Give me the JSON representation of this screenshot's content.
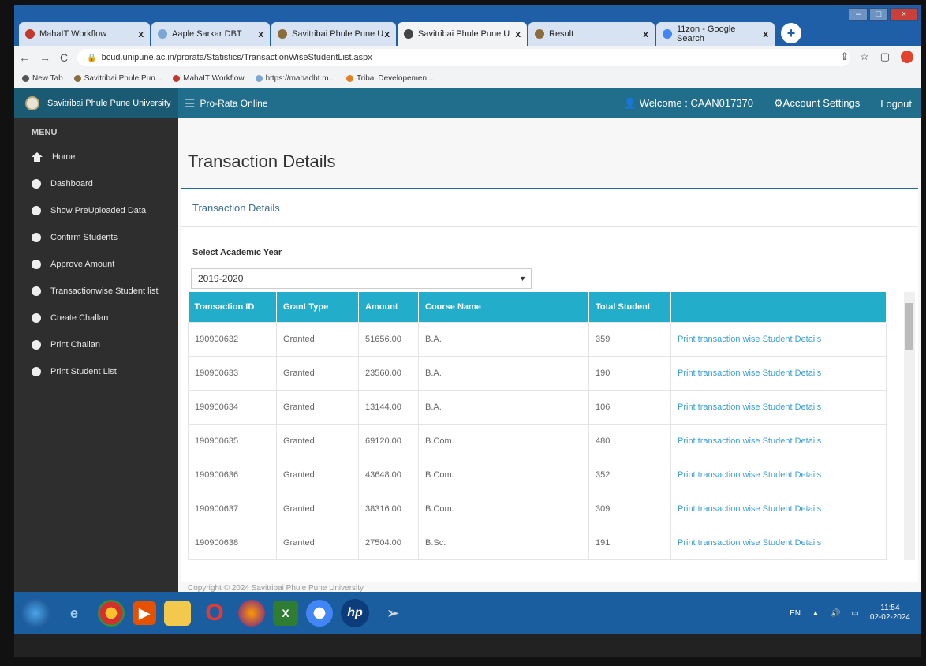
{
  "browser": {
    "tabs": [
      {
        "label": "MahaIT Workflow",
        "close": "x"
      },
      {
        "label": "Aaple Sarkar DBT",
        "close": "x"
      },
      {
        "label": "Savitribai Phule Pune U",
        "close": "x"
      },
      {
        "label": "Savitribai Phule Pune U",
        "close": "x"
      },
      {
        "label": "Result",
        "close": "x"
      },
      {
        "label": "11zon - Google Search",
        "close": "x"
      }
    ],
    "url": "bcud.unipune.ac.in/prorata/Statistics/TransactionWiseStudentList.aspx",
    "bookmarks": [
      "New Tab",
      "Savitribai Phule Pun...",
      "MahaIT Workflow",
      "https://mahadbt.m...",
      "Tribal Developemen..."
    ]
  },
  "header": {
    "brand": "Savitribai Phule Pune University",
    "app_name": "Pro-Rata Online",
    "welcome": "Welcome : CAAN017370",
    "account_settings": "Account Settings",
    "logout": "Logout"
  },
  "sidebar": {
    "title": "MENU",
    "items": [
      {
        "label": "Home",
        "icon": "home-icon"
      },
      {
        "label": "Dashboard",
        "icon": "dashboard-icon"
      },
      {
        "label": "Show PreUploaded Data",
        "icon": "circle-icon"
      },
      {
        "label": "Confirm Students",
        "icon": "circle-icon"
      },
      {
        "label": "Approve Amount",
        "icon": "circle-icon"
      },
      {
        "label": "Transactionwise Student list",
        "icon": "circle-icon"
      },
      {
        "label": "Create Challan",
        "icon": "circle-icon"
      },
      {
        "label": "Print Challan",
        "icon": "circle-icon"
      },
      {
        "label": "Print Student List",
        "icon": "circle-icon"
      }
    ]
  },
  "main": {
    "page_title": "Transaction Details",
    "panel_title": "Transaction Details",
    "year_label": "Select Academic Year",
    "year_value": "2019-2020",
    "columns": [
      "Transaction ID",
      "Grant Type",
      "Amount",
      "Course Name",
      "Total Student",
      ""
    ],
    "rows": [
      {
        "id": "190900632",
        "grant": "Granted",
        "amount": "51656.00",
        "course": "B.A.",
        "total": "359",
        "action": "Print transaction wise Student Details"
      },
      {
        "id": "190900633",
        "grant": "Granted",
        "amount": "23560.00",
        "course": "B.A.",
        "total": "190",
        "action": "Print transaction wise Student Details"
      },
      {
        "id": "190900634",
        "grant": "Granted",
        "amount": "13144.00",
        "course": "B.A.",
        "total": "106",
        "action": "Print transaction wise Student Details"
      },
      {
        "id": "190900635",
        "grant": "Granted",
        "amount": "69120.00",
        "course": "B.Com.",
        "total": "480",
        "action": "Print transaction wise Student Details"
      },
      {
        "id": "190900636",
        "grant": "Granted",
        "amount": "43648.00",
        "course": "B.Com.",
        "total": "352",
        "action": "Print transaction wise Student Details"
      },
      {
        "id": "190900637",
        "grant": "Granted",
        "amount": "38316.00",
        "course": "B.Com.",
        "total": "309",
        "action": "Print transaction wise Student Details"
      },
      {
        "id": "190900638",
        "grant": "Granted",
        "amount": "27504.00",
        "course": "B.Sc.",
        "total": "191",
        "action": "Print transaction wise Student Details"
      }
    ],
    "copyright": "Copyright © 2024 Savitribai Phule Pune University"
  },
  "taskbar": {
    "lang": "EN",
    "time": "11:54",
    "date": "02-02-2024"
  },
  "colors": {
    "header": "#216e8c",
    "table_header": "#22aecb",
    "sidebar": "#2e2e2e",
    "link": "#3a9fd0"
  }
}
